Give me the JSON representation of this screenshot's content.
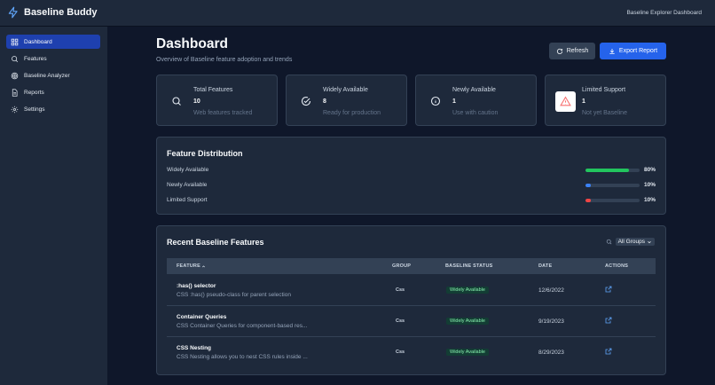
{
  "app": {
    "name": "Baseline Buddy",
    "header_right": "Baseline Explorer Dashboard"
  },
  "sidebar": {
    "items": [
      {
        "label": "Dashboard",
        "icon": "dashboard-icon",
        "active": true
      },
      {
        "label": "Features",
        "icon": "search-icon"
      },
      {
        "label": "Baseline Analyzer",
        "icon": "target-icon"
      },
      {
        "label": "Reports",
        "icon": "document-icon"
      },
      {
        "label": "Settings",
        "icon": "gear-icon"
      }
    ]
  },
  "page": {
    "title": "Dashboard",
    "subtitle": "Overview of Baseline feature adoption and trends",
    "refresh_label": "Refresh",
    "export_label": "Export Report"
  },
  "stats": [
    {
      "label": "Total Features",
      "value": "10",
      "desc": "Web features tracked",
      "icon": "search-icon"
    },
    {
      "label": "Widely Available",
      "value": "8",
      "desc": "Ready for production",
      "icon": "check-circle-icon"
    },
    {
      "label": "Newly Available",
      "value": "1",
      "desc": "Use with caution",
      "icon": "info-icon"
    },
    {
      "label": "Limited Support",
      "value": "1",
      "desc": "Not yet Baseline",
      "icon": "warning-icon"
    }
  ],
  "distribution": {
    "title": "Feature Distribution",
    "items": [
      {
        "label": "Widely Available",
        "pct_label": "80%",
        "fraction": 0.8,
        "color": "#22c55e"
      },
      {
        "label": "Newly Available",
        "pct_label": "10%",
        "fraction": 0.1,
        "color": "#3b82f6"
      },
      {
        "label": "Limited Support",
        "pct_label": "10%",
        "fraction": 0.1,
        "color": "#ef4444"
      }
    ]
  },
  "recent": {
    "title": "Recent Baseline Features",
    "filter_value": "All Groups",
    "columns": {
      "feature": "FEATURE",
      "group": "GROUP",
      "status": "BASELINE STATUS",
      "date": "DATE",
      "actions": "ACTIONS"
    },
    "rows": [
      {
        "name": ":has() selector",
        "desc": "CSS :has() pseudo-class for parent selection",
        "group": "Css",
        "status": "Widely Available",
        "date": "12/6/2022"
      },
      {
        "name": "Container Queries",
        "desc": "CSS Container Queries for component-based res...",
        "group": "Css",
        "status": "Widely Available",
        "date": "9/19/2023"
      },
      {
        "name": "CSS Nesting",
        "desc": "CSS Nesting allows you to nest CSS rules inside ...",
        "group": "Css",
        "status": "Widely Available",
        "date": "8/29/2023"
      }
    ]
  },
  "colors": {
    "accent": "#2563eb",
    "active_nav": "#1e40af",
    "background": "#0f172a",
    "surface": "#1e293b"
  }
}
